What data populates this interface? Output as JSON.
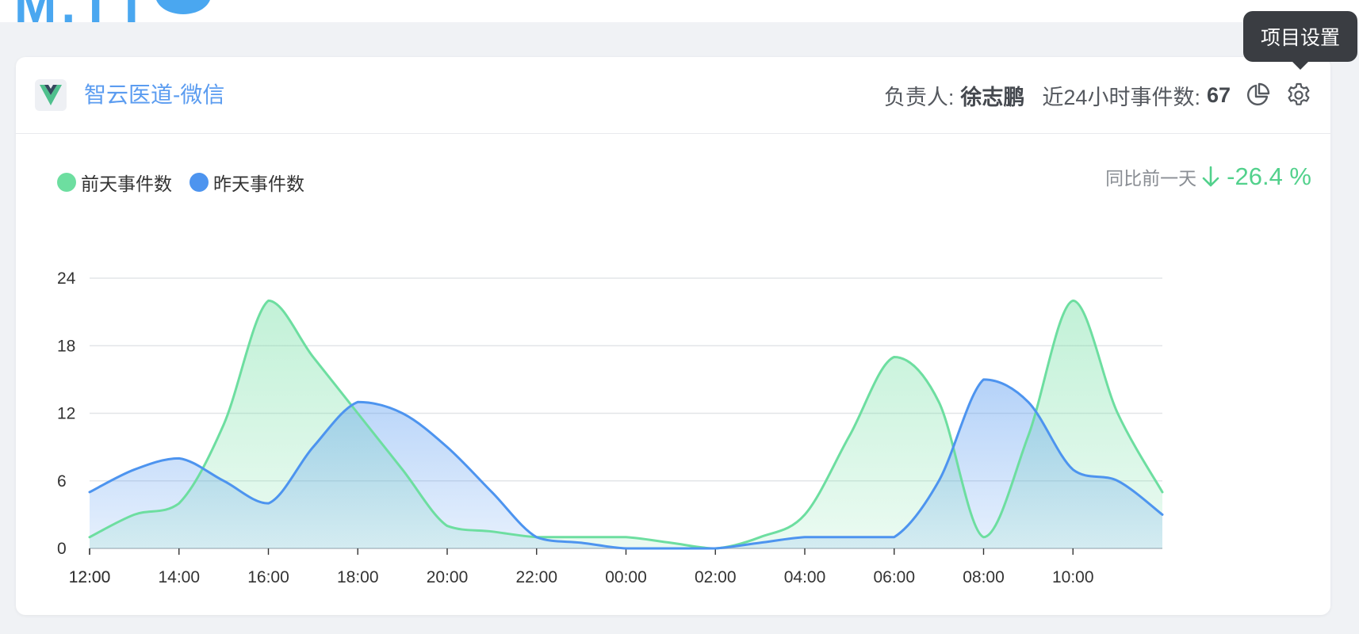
{
  "tooltip": {
    "text": "项目设置"
  },
  "project": {
    "name": "智云医道-微信",
    "owner_label": "负责人:",
    "owner_name": "徐志鹏",
    "count_label": "近24小时事件数:",
    "count_value": "67"
  },
  "icons": {
    "project_logo": "vue-logo-icon",
    "stats": "pie-chart-icon",
    "settings": "gear-icon",
    "compare_arrow": "arrow-down-icon"
  },
  "compare": {
    "label": "同比前一天",
    "value": "-26.4 %",
    "color": "#52d18c"
  },
  "chart_data": {
    "type": "area",
    "x": [
      "12:00",
      "13:00",
      "14:00",
      "15:00",
      "16:00",
      "17:00",
      "18:00",
      "19:00",
      "20:00",
      "21:00",
      "22:00",
      "23:00",
      "00:00",
      "01:00",
      "02:00",
      "03:00",
      "04:00",
      "05:00",
      "06:00",
      "07:00",
      "08:00",
      "09:00",
      "10:00",
      "11:00",
      "12:00"
    ],
    "xticks": [
      "12:00",
      "14:00",
      "16:00",
      "18:00",
      "20:00",
      "22:00",
      "00:00",
      "02:00",
      "04:00",
      "06:00",
      "08:00",
      "10:00",
      "12:00"
    ],
    "yticks": [
      0,
      6,
      12,
      18,
      24
    ],
    "ylim": [
      0,
      24
    ],
    "grid": true,
    "legend_position": "top-left",
    "series": [
      {
        "name": "前天事件数",
        "color": "#6ddea0",
        "values": [
          1,
          3,
          4,
          11,
          22,
          17,
          12,
          7,
          2,
          1.5,
          1,
          1,
          1,
          0.5,
          0,
          1,
          3,
          10,
          17,
          13,
          1,
          10,
          22,
          12,
          5
        ]
      },
      {
        "name": "昨天事件数",
        "color": "#4d94ef",
        "values": [
          5,
          7,
          8,
          6,
          4,
          9,
          13,
          12,
          9,
          5,
          1,
          0.5,
          0,
          0,
          0,
          0.5,
          1,
          1,
          1,
          6,
          15,
          13,
          7,
          6,
          3
        ]
      }
    ]
  }
}
